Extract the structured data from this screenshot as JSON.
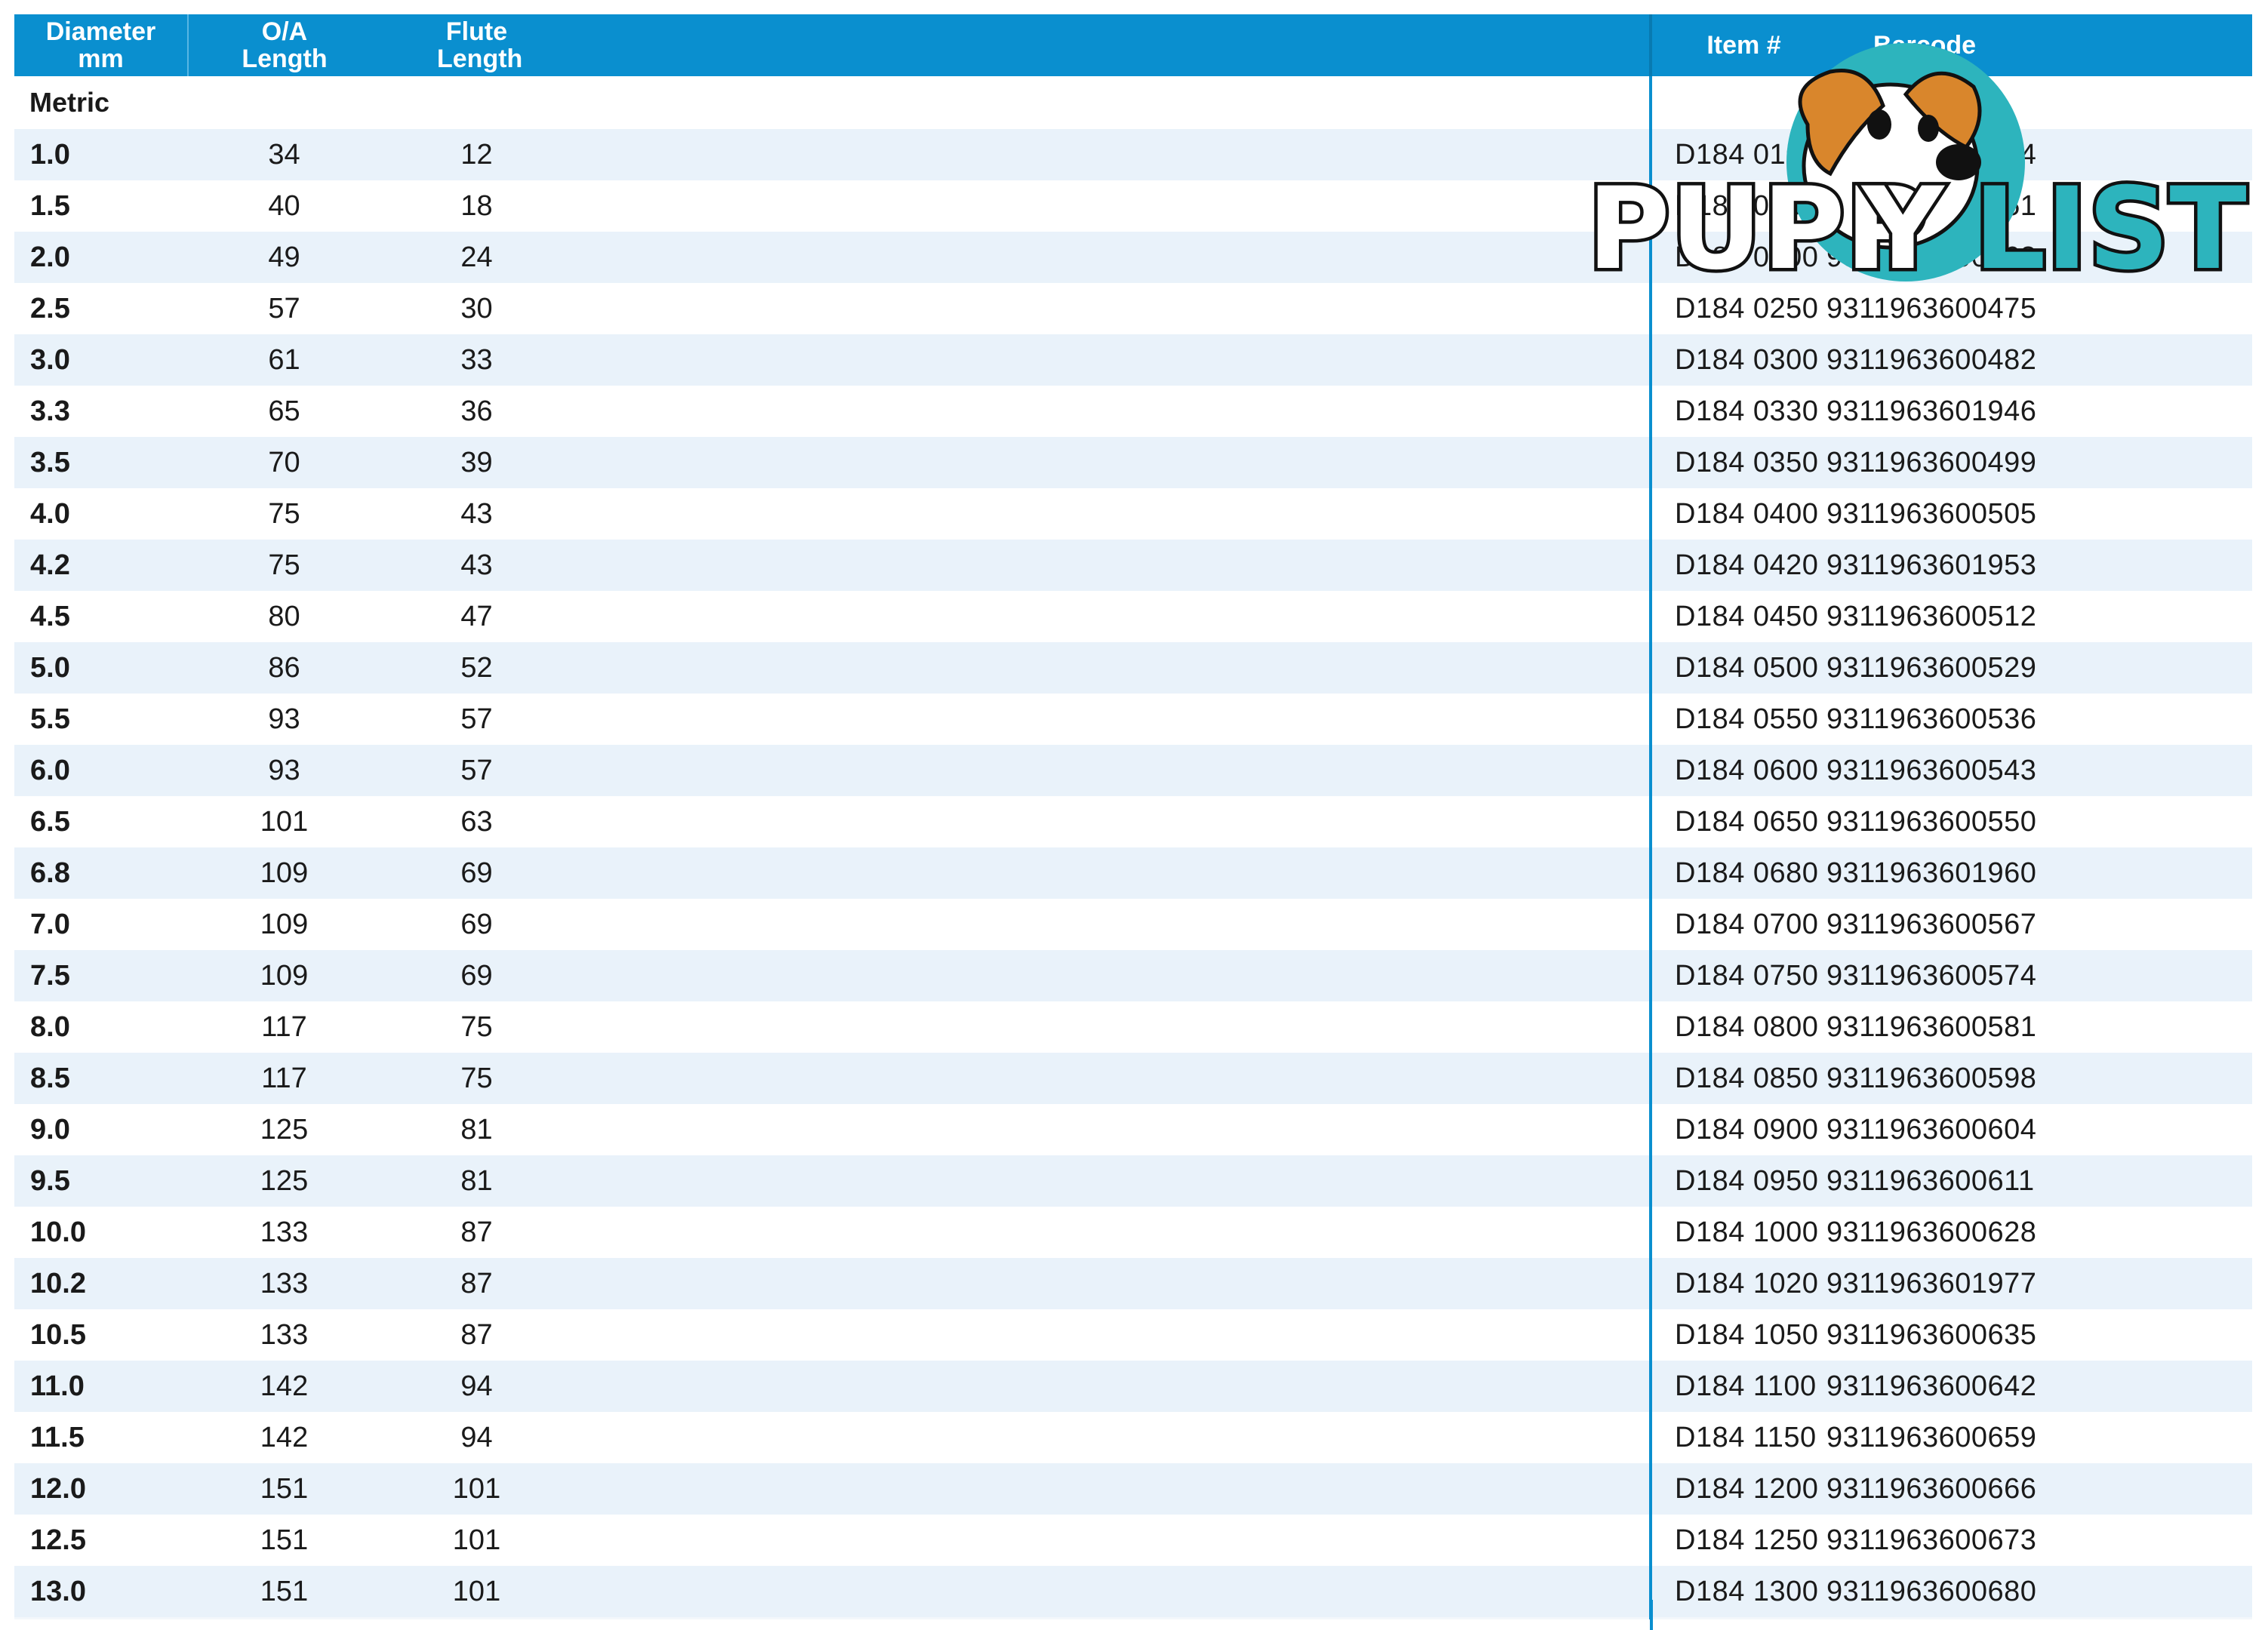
{
  "table": {
    "headers": {
      "diameter": "Diameter mm",
      "oa_length": "O/A Length",
      "flute_length": "Flute Length",
      "item": "Item #",
      "barcode": "Barcode"
    },
    "section_label": "Metric",
    "rows": [
      {
        "diameter": "1.0",
        "oa_length": "34",
        "flute_length": "12",
        "item": "D184 0100",
        "barcode": "9311963600444"
      },
      {
        "diameter": "1.5",
        "oa_length": "40",
        "flute_length": "18",
        "item": "D184 0150",
        "barcode": "9311963600451"
      },
      {
        "diameter": "2.0",
        "oa_length": "49",
        "flute_length": "24",
        "item": "D184 0200",
        "barcode": "9311963600468"
      },
      {
        "diameter": "2.5",
        "oa_length": "57",
        "flute_length": "30",
        "item": "D184 0250",
        "barcode": "9311963600475"
      },
      {
        "diameter": "3.0",
        "oa_length": "61",
        "flute_length": "33",
        "item": "D184 0300",
        "barcode": "9311963600482"
      },
      {
        "diameter": "3.3",
        "oa_length": "65",
        "flute_length": "36",
        "item": "D184 0330",
        "barcode": "9311963601946"
      },
      {
        "diameter": "3.5",
        "oa_length": "70",
        "flute_length": "39",
        "item": "D184 0350",
        "barcode": "9311963600499"
      },
      {
        "diameter": "4.0",
        "oa_length": "75",
        "flute_length": "43",
        "item": "D184 0400",
        "barcode": "9311963600505"
      },
      {
        "diameter": "4.2",
        "oa_length": "75",
        "flute_length": "43",
        "item": "D184 0420",
        "barcode": "9311963601953"
      },
      {
        "diameter": "4.5",
        "oa_length": "80",
        "flute_length": "47",
        "item": "D184 0450",
        "barcode": "9311963600512"
      },
      {
        "diameter": "5.0",
        "oa_length": "86",
        "flute_length": "52",
        "item": "D184 0500",
        "barcode": "9311963600529"
      },
      {
        "diameter": "5.5",
        "oa_length": "93",
        "flute_length": "57",
        "item": "D184 0550",
        "barcode": "9311963600536"
      },
      {
        "diameter": "6.0",
        "oa_length": "93",
        "flute_length": "57",
        "item": "D184 0600",
        "barcode": "9311963600543"
      },
      {
        "diameter": "6.5",
        "oa_length": "101",
        "flute_length": "63",
        "item": "D184 0650",
        "barcode": "9311963600550"
      },
      {
        "diameter": "6.8",
        "oa_length": "109",
        "flute_length": "69",
        "item": "D184 0680",
        "barcode": "9311963601960"
      },
      {
        "diameter": "7.0",
        "oa_length": "109",
        "flute_length": "69",
        "item": "D184 0700",
        "barcode": "9311963600567"
      },
      {
        "diameter": "7.5",
        "oa_length": "109",
        "flute_length": "69",
        "item": "D184 0750",
        "barcode": "9311963600574"
      },
      {
        "diameter": "8.0",
        "oa_length": "117",
        "flute_length": "75",
        "item": "D184 0800",
        "barcode": "9311963600581"
      },
      {
        "diameter": "8.5",
        "oa_length": "117",
        "flute_length": "75",
        "item": "D184 0850",
        "barcode": "9311963600598"
      },
      {
        "diameter": "9.0",
        "oa_length": "125",
        "flute_length": "81",
        "item": "D184 0900",
        "barcode": "9311963600604"
      },
      {
        "diameter": "9.5",
        "oa_length": "125",
        "flute_length": "81",
        "item": "D184 0950",
        "barcode": "9311963600611"
      },
      {
        "diameter": "10.0",
        "oa_length": "133",
        "flute_length": "87",
        "item": "D184 1000",
        "barcode": "9311963600628"
      },
      {
        "diameter": "10.2",
        "oa_length": "133",
        "flute_length": "87",
        "item": "D184 1020",
        "barcode": "9311963601977"
      },
      {
        "diameter": "10.5",
        "oa_length": "133",
        "flute_length": "87",
        "item": "D184 1050",
        "barcode": "9311963600635"
      },
      {
        "diameter": "11.0",
        "oa_length": "142",
        "flute_length": "94",
        "item": "D184 1100",
        "barcode": "9311963600642"
      },
      {
        "diameter": "11.5",
        "oa_length": "142",
        "flute_length": "94",
        "item": "D184 1150",
        "barcode": "9311963600659"
      },
      {
        "diameter": "12.0",
        "oa_length": "151",
        "flute_length": "101",
        "item": "D184 1200",
        "barcode": "9311963600666"
      },
      {
        "diameter": "12.5",
        "oa_length": "151",
        "flute_length": "101",
        "item": "D184 1250",
        "barcode": "9311963600673"
      },
      {
        "diameter": "13.0",
        "oa_length": "151",
        "flute_length": "101",
        "item": "D184 1300",
        "barcode": "9311963600680"
      }
    ]
  },
  "watermark": {
    "text": "PUPPYLIST",
    "text_part1": "PUPP",
    "text_y": "Y",
    "text_part2": "LIST",
    "colors": {
      "fill_dark": "#ffffff",
      "fill_accent": "#2db4bd",
      "outline": "#111111",
      "circle": "#2db4bd",
      "dog_orange": "#d9862c"
    }
  },
  "colors": {
    "header_bg": "#0a8fcf",
    "stripe": "#e9f2fa",
    "divider": "#0a8fcf"
  }
}
